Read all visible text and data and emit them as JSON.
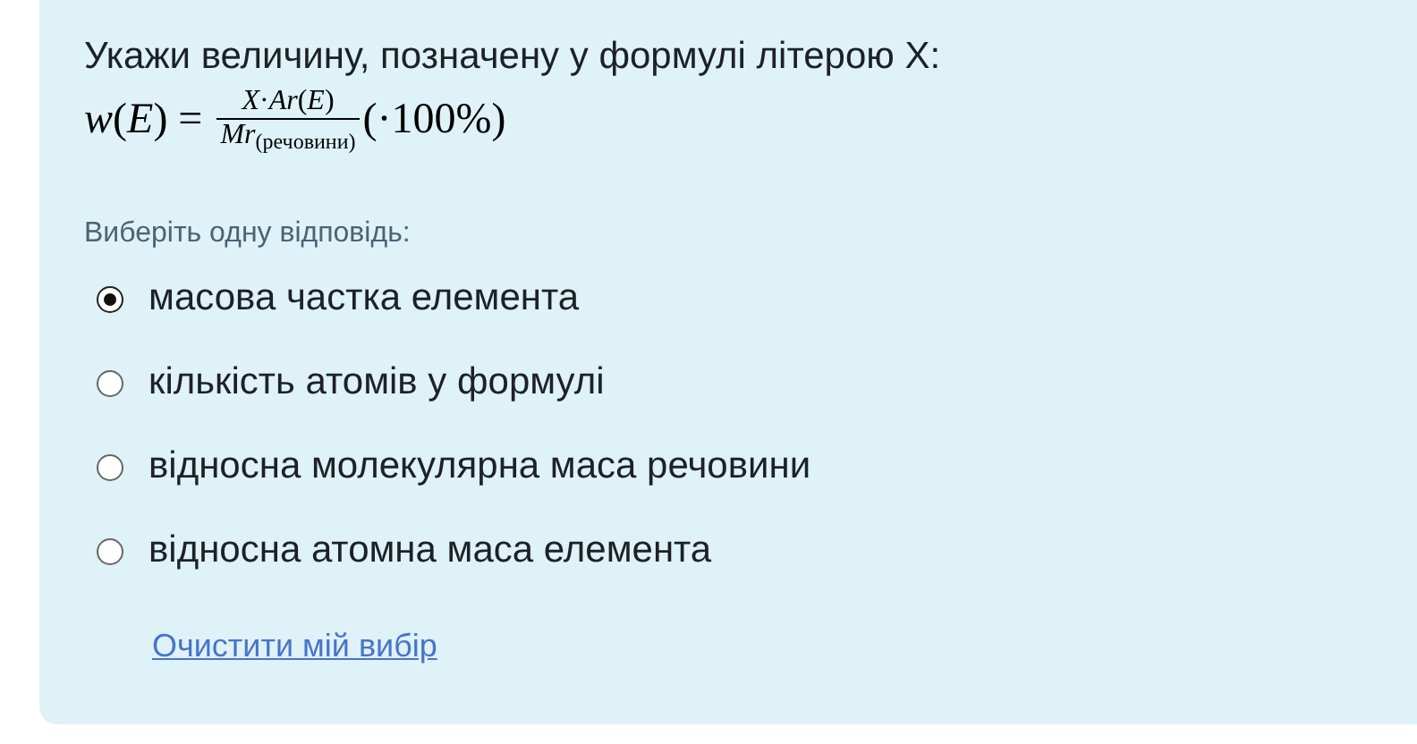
{
  "question": {
    "prompt": "Укажи величину, позначену у формулі літерою X:",
    "formula": {
      "lhs": "*w*(*E*) =",
      "numerator": "*X*·*Ar*(*E*)",
      "denominator": "*Mr*$_{(речовини)}$",
      "suffix": "(·100%)"
    }
  },
  "instruction": "Виберіть одну відповідь:",
  "options": [
    {
      "label": "масова частка елемента",
      "selected": true
    },
    {
      "label": "кількість атомів у формулі",
      "selected": false
    },
    {
      "label": "відносна молекулярна маса речовини",
      "selected": false
    },
    {
      "label": "відносна атомна маса елемента",
      "selected": false
    }
  ],
  "clear_link": "Очистити мій вибір"
}
